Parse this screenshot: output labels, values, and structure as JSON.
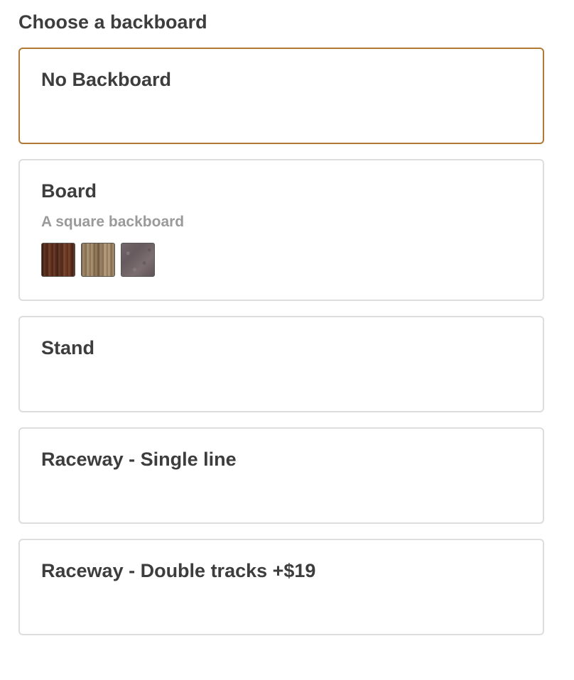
{
  "heading": "Choose a backboard",
  "accent_color": "#b07a35",
  "options": [
    {
      "title": "No Backboard",
      "selected": true
    },
    {
      "title": "Board",
      "description": "A square backboard",
      "swatches": [
        "dark-wood",
        "light-wood",
        "grey-stone"
      ]
    },
    {
      "title": "Stand"
    },
    {
      "title": "Raceway - Single line"
    },
    {
      "title": "Raceway - Double tracks +$19"
    }
  ]
}
